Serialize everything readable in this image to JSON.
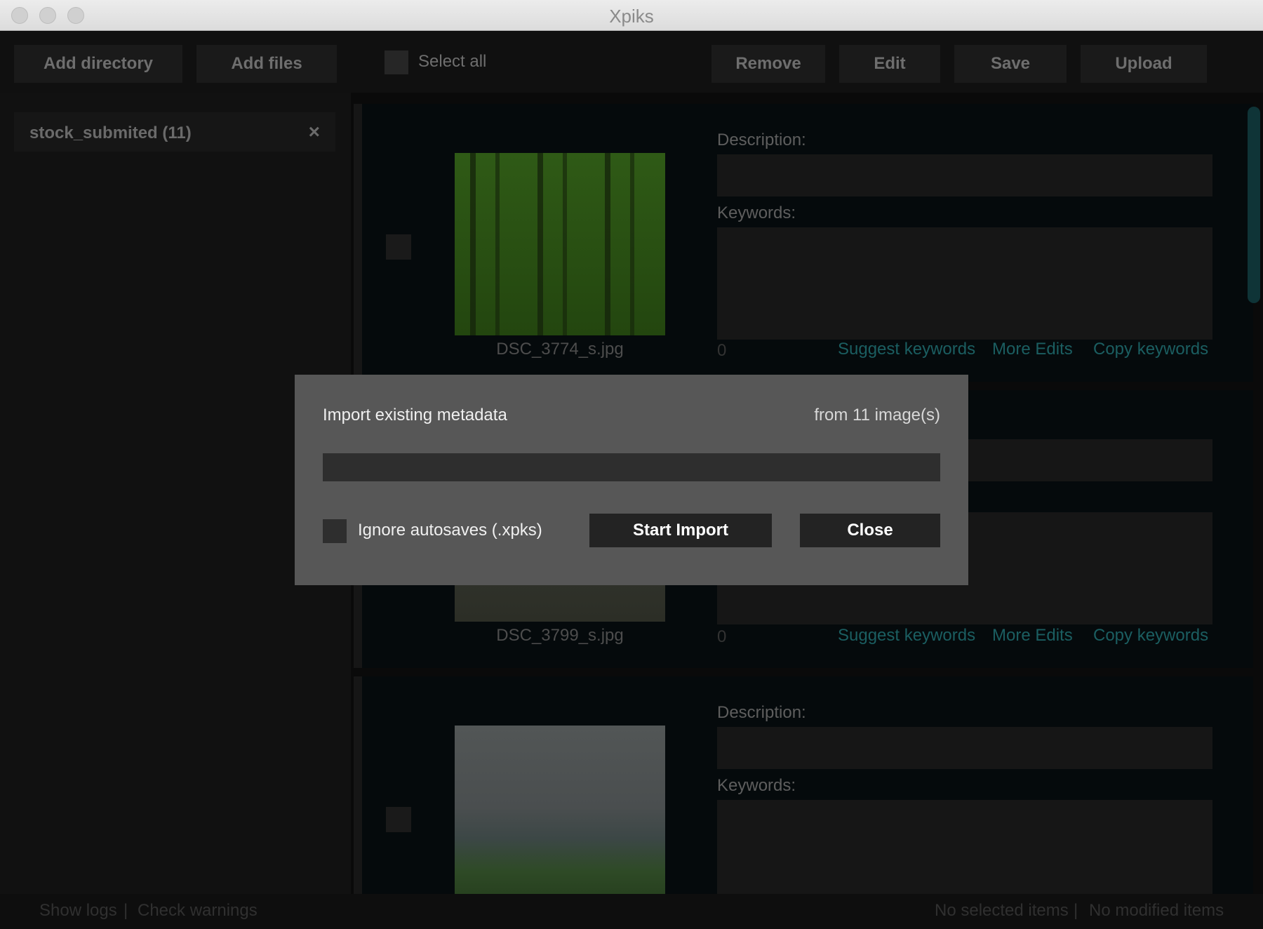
{
  "window": {
    "title": "Xpiks"
  },
  "toolbar": {
    "add_directory": "Add directory",
    "add_files": "Add files",
    "select_all": "Select all",
    "remove": "Remove",
    "edit": "Edit",
    "save": "Save",
    "upload": "Upload"
  },
  "sidebar": {
    "items": [
      {
        "label": "stock_submited (11)",
        "close_icon": "×"
      }
    ]
  },
  "artworks": [
    {
      "filename": "DSC_3774_s.jpg",
      "description_label": "Description:",
      "keywords_label": "Keywords:",
      "keyword_count": "0",
      "suggest_label": "Suggest keywords",
      "more_label": "More Edits",
      "copy_label": "Copy keywords"
    },
    {
      "filename": "DSC_3799_s.jpg",
      "keyword_count": "0",
      "suggest_label": "Suggest keywords",
      "more_label": "More Edits",
      "copy_label": "Copy keywords"
    },
    {
      "description_label": "Description:",
      "keywords_label": "Keywords:"
    }
  ],
  "status": {
    "show_logs": "Show logs",
    "separator": "|",
    "check_warnings": "Check warnings",
    "selected": "No selected items",
    "modified": "No modified items"
  },
  "dialog": {
    "title": "Import existing metadata",
    "subtitle": "from 11 image(s)",
    "progress": 0,
    "ignore_autosaves_label": "Ignore autosaves (.xpks)",
    "ignore_autosaves_checked": false,
    "start_label": "Start Import",
    "close_label": "Close"
  },
  "colors": {
    "accent_link": "#1b5e61",
    "dialog_bg": "#575757",
    "app_bg": "#0a0a0a"
  }
}
